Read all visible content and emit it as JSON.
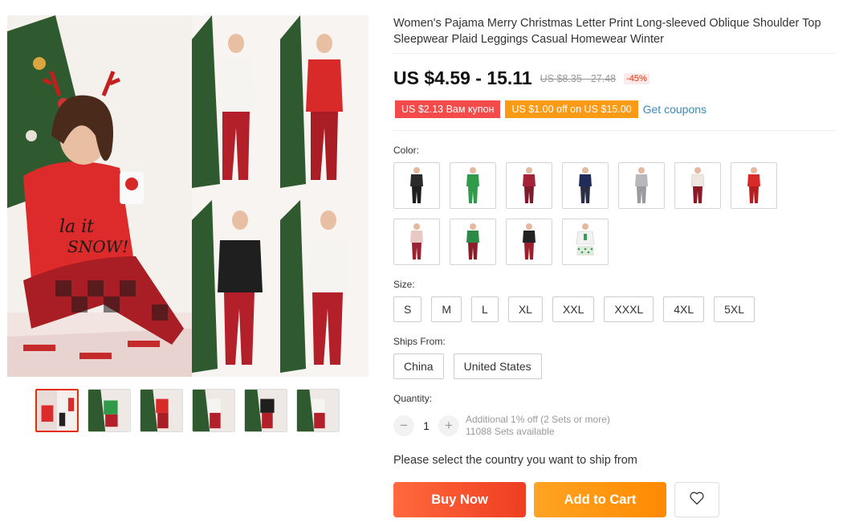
{
  "product": {
    "title": "Women's Pajama Merry Christmas Letter Print Long-sleeved Oblique Shoulder Top Sleepwear Plaid Leggings Casual Homewear Winter",
    "price": "US $4.59 - 15.11",
    "old_price": "US $8.35 - 27.48",
    "discount": "-45%"
  },
  "coupons": {
    "store_coupon": "US $2.13 Вам купон",
    "select_coupon": "US $1.00 off on US $15.00",
    "get_coupons": "Get coupons"
  },
  "color": {
    "label": "Color:",
    "swatches": [
      {
        "name": "black-deer",
        "top": "#2a2a2a",
        "bottom": "#1e1e1e"
      },
      {
        "name": "green",
        "top": "#2f9b4a",
        "bottom": "#2f9b4a"
      },
      {
        "name": "wine-red",
        "top": "#a4223a",
        "bottom": "#7e1a2c"
      },
      {
        "name": "navy",
        "top": "#1f2c5a",
        "bottom": "#2a2f45"
      },
      {
        "name": "gray",
        "top": "#b8b8bc",
        "bottom": "#9a9aa0"
      },
      {
        "name": "white-plaid",
        "top": "#efe6e0",
        "bottom": "#8b1a26"
      },
      {
        "name": "red",
        "top": "#d92a2a",
        "bottom": "#b51e1e"
      },
      {
        "name": "pink-plaid",
        "top": "#e8c9c4",
        "bottom": "#9b2233"
      },
      {
        "name": "green-plaid",
        "top": "#2d8a45",
        "bottom": "#8a1e2a"
      },
      {
        "name": "black-plaid",
        "top": "#222222",
        "bottom": "#9b1f2d"
      },
      {
        "name": "cactus-shorts",
        "top": "#f2f2f2",
        "bottom": "#dfe9dd"
      }
    ]
  },
  "size": {
    "label": "Size:",
    "options": [
      "S",
      "M",
      "L",
      "XL",
      "XXL",
      "XXXL",
      "4XL",
      "5XL"
    ]
  },
  "ships_from": {
    "label": "Ships From:",
    "options": [
      "China",
      "United States"
    ]
  },
  "quantity": {
    "label": "Quantity:",
    "minus": "−",
    "value": "1",
    "plus": "+",
    "additional": "Additional 1% off (2 Sets or more)",
    "available": "11088 Sets available"
  },
  "ship_note": "Please select the country you want to ship from",
  "actions": {
    "buy_now": "Buy Now",
    "add_to_cart": "Add to Cart"
  },
  "colors": {
    "accent_red": "#e62e04",
    "link_blue": "#3a8bbb",
    "coupon_red": "#f44a4a",
    "coupon_orange": "#fb9a15",
    "buy_gradient_start": "#ff6a3d",
    "cart_gradient_start": "#ffa423"
  },
  "icons": {
    "wishlist": "heart-icon"
  },
  "gallery": {
    "thumbnail_count": 6,
    "active_index": 0
  }
}
